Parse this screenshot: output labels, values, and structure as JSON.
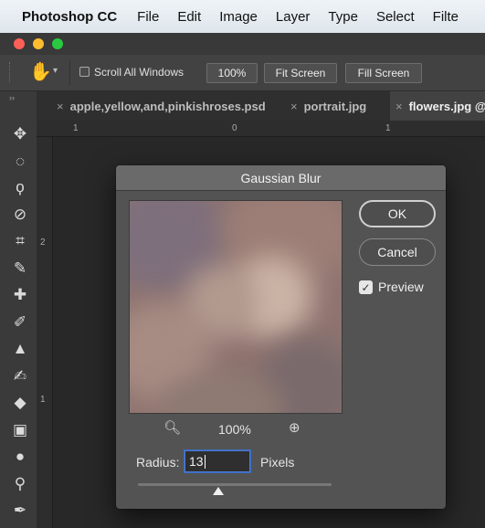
{
  "menubar": {
    "app_name": "Photoshop CC",
    "items": [
      "File",
      "Edit",
      "Image",
      "Layer",
      "Type",
      "Select",
      "Filte"
    ]
  },
  "options_bar": {
    "scroll_all_windows_label": "Scroll All Windows",
    "scroll_all_windows_checked": false,
    "zoom_100_label": "100%",
    "fit_screen_label": "Fit Screen",
    "fill_screen_label": "Fill Screen",
    "tool_icon": "hand-icon"
  },
  "tabs": [
    {
      "label": "apple,yellow,and,pinkishroses.psd",
      "active": false
    },
    {
      "label": "portrait.jpg",
      "active": false
    },
    {
      "label": "flowers.jpg @",
      "active": true
    }
  ],
  "rulers": {
    "top_labels": [
      "1",
      "0",
      "1"
    ],
    "left_labels": [
      "2",
      "1"
    ]
  },
  "tools": [
    "move-icon",
    "marquee-icon",
    "lasso-icon",
    "quick-select-icon",
    "crop-icon",
    "eyedropper-icon",
    "healing-brush-icon",
    "brush-icon",
    "clone-stamp-icon",
    "history-brush-icon",
    "eraser-icon",
    "gradient-icon",
    "blur-icon",
    "dodge-icon",
    "pen-icon"
  ],
  "dialog": {
    "title": "Gaussian Blur",
    "ok_label": "OK",
    "cancel_label": "Cancel",
    "preview_label": "Preview",
    "preview_checked": true,
    "zoom_level": "100%",
    "radius_label": "Radius:",
    "radius_value": "13",
    "radius_unit": "Pixels"
  },
  "colors": {
    "menubar_bg": "#e6ecf1",
    "panel_bg": "#535353",
    "dialog_focus": "#4a7bd0"
  }
}
